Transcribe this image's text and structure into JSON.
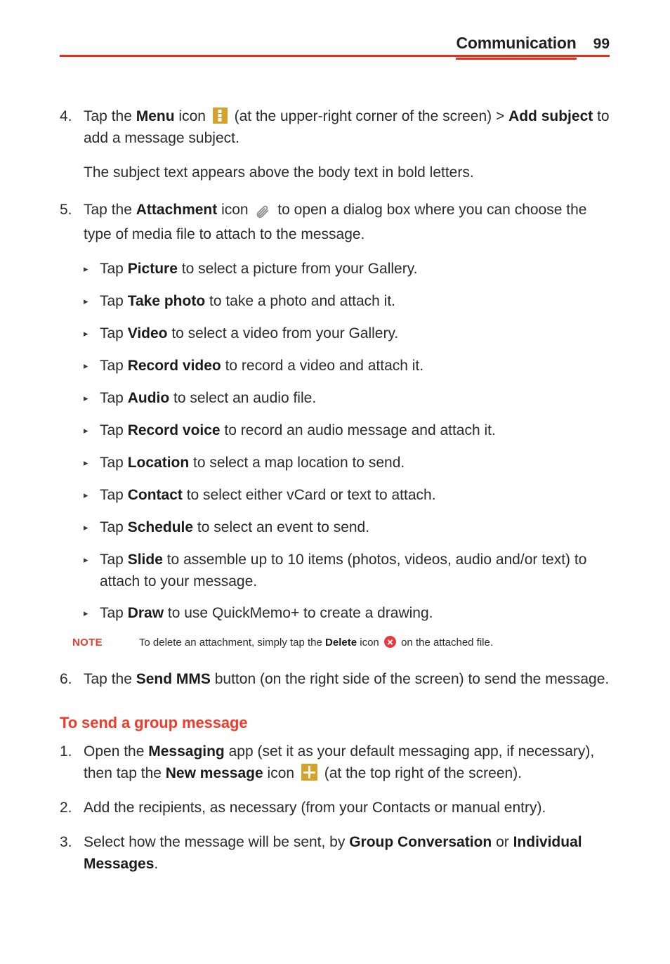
{
  "header": {
    "title": "Communication",
    "page_number": "99"
  },
  "steps_mms": [
    {
      "number": "4.",
      "segments": [
        {
          "t": "Tap the ",
          "b": false
        },
        {
          "t": "Menu",
          "b": true
        },
        {
          "t": " icon ",
          "b": false
        },
        {
          "icon": "menu-icon"
        },
        {
          "t": " (at the upper-right corner of the screen) > ",
          "b": false
        },
        {
          "t": "Add subject",
          "b": true
        },
        {
          "t": " to add a message subject.",
          "b": false
        }
      ]
    },
    {
      "number": "5.",
      "segments": [
        {
          "t": "Tap the ",
          "b": false
        },
        {
          "t": "Attachment",
          "b": true
        },
        {
          "t": " icon ",
          "b": false
        },
        {
          "icon": "paperclip-icon"
        },
        {
          "t": " to open a dialog box where you can choose the type of media file to attach to the message.",
          "b": false
        }
      ]
    },
    {
      "number": "6.",
      "segments": [
        {
          "t": "Tap the ",
          "b": false
        },
        {
          "t": "Send MMS",
          "b": true
        },
        {
          "t": " button (on the right side of the screen) to send the message.",
          "b": false
        }
      ]
    }
  ],
  "subject_note": "The subject text appears above the body text in bold letters.",
  "attachment_options": [
    {
      "lead": "Tap ",
      "term": "Picture",
      "rest": " to select a picture from your Gallery."
    },
    {
      "lead": "Tap ",
      "term": "Take photo",
      "rest": " to take a photo and attach it."
    },
    {
      "lead": "Tap ",
      "term": "Video",
      "rest": " to select a video from your Gallery."
    },
    {
      "lead": "Tap ",
      "term": "Record video",
      "rest": " to record a video and attach it."
    },
    {
      "lead": "Tap ",
      "term": "Audio",
      "rest": " to select an audio file."
    },
    {
      "lead": "Tap ",
      "term": "Record voice",
      "rest": " to record an audio message and attach it."
    },
    {
      "lead": "Tap ",
      "term": "Location",
      "rest": " to select a map location to send."
    },
    {
      "lead": "Tap ",
      "term": "Contact",
      "rest": " to select either vCard or text to attach."
    },
    {
      "lead": "Tap ",
      "term": "Schedule",
      "rest": " to select an event to send."
    },
    {
      "lead": "Tap ",
      "term": "Slide",
      "rest": " to assemble up to 10 items (photos, videos, audio and/or text) to attach to your message."
    },
    {
      "lead": "Tap ",
      "term": "Draw",
      "rest": " to use QuickMemo+ to create a drawing."
    }
  ],
  "note": {
    "label": "NOTE",
    "text_before": "To delete an attachment, simply tap the ",
    "term": "Delete",
    "text_middle": " icon ",
    "text_after": " on the attached file."
  },
  "group_section": {
    "heading": "To send a group message",
    "steps": [
      {
        "number": "1.",
        "segments": [
          {
            "t": "Open the ",
            "b": false
          },
          {
            "t": "Messaging",
            "b": true
          },
          {
            "t": " app (set it as your default messaging app, if necessary), then tap the ",
            "b": false
          },
          {
            "t": "New message",
            "b": true
          },
          {
            "t": " icon ",
            "b": false
          },
          {
            "icon": "plus-icon"
          },
          {
            "t": " (at the top right of the screen).",
            "b": false
          }
        ]
      },
      {
        "number": "2.",
        "segments": [
          {
            "t": "Add the recipients, as necessary (from your Contacts or manual entry).",
            "b": false
          }
        ]
      },
      {
        "number": "3.",
        "segments": [
          {
            "t": "Select how the message will be sent, by ",
            "b": false
          },
          {
            "t": "Group Conversation",
            "b": true
          },
          {
            "t": " or ",
            "b": false
          },
          {
            "t": "Individual Messages",
            "b": true
          },
          {
            "t": ".",
            "b": false
          }
        ]
      }
    ]
  },
  "bullet_marker": "▸",
  "colors": {
    "accent_red": "#e0301e",
    "heading_red": "#ee3b2b",
    "icon_gold": "#d6a22e",
    "delete_red": "#e8383d",
    "body_text": "#2b2b2b"
  }
}
